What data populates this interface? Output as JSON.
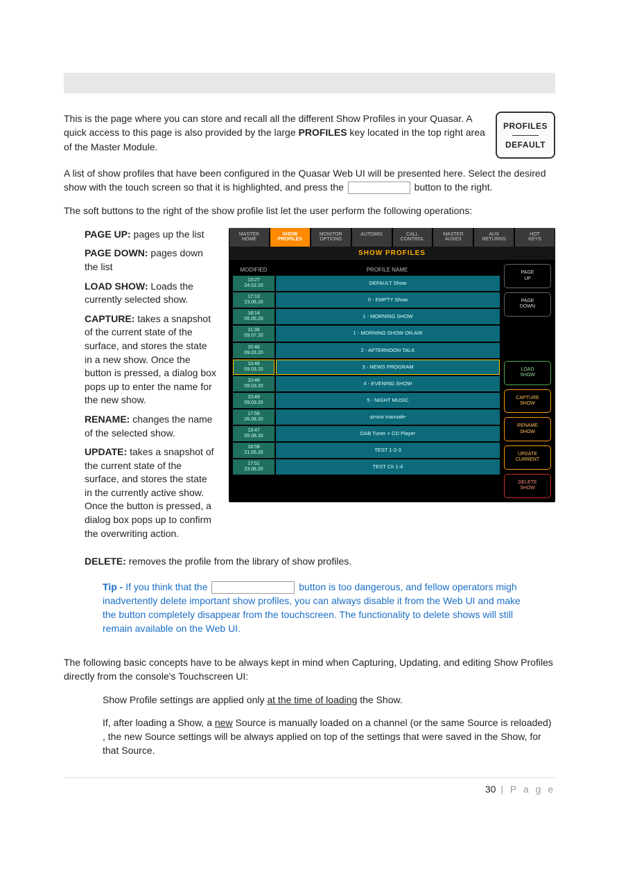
{
  "topbar": "",
  "intro": {
    "p1a": "This is the page where you can store and recall all the different Show Profiles in your Quasar. A quick access to this page is also provided by the large ",
    "p1b": "PROFILES",
    "p1c": " key located in the top right area of the Master Module.",
    "key_top": "PROFILES",
    "key_bottom": "DEFAULT"
  },
  "p2a": "A list of show profiles that have been configured in the Quasar Web UI will be presented here. Select the desired show with the touch screen so that it is highlighted, and press the ",
  "p2b": " button to the right.",
  "p3": "The soft buttons to the right of the show profile list  let the user perform the following operations:",
  "defs": {
    "pageup_l": "PAGE UP:",
    "pageup_t": " pages up the list",
    "pagedown_l": "PAGE DOWN:",
    "pagedown_t": " pages down the list",
    "load_l": "LOAD SHOW:",
    "load_t": " Loads the currently selected show.",
    "capture_l": "CAPTURE:",
    "capture_t": " takes a snapshot of the current state of the surface, and stores the state in a new show. Once the button is pressed, a dialog box pops up to enter the name for the new show.",
    "rename_l": "RENAME:",
    "rename_t": " changes the name of the selected show.",
    "update_l": "UPDATE:",
    "update_t": " takes a snapshot of the current state of the surface, and stores the state in the currently active show. Once the button is pressed, a dialog box pops up to confirm the overwriting action."
  },
  "delete_l": "DELETE:",
  "delete_t": " removes the profile from the library of show profiles.",
  "screenshot": {
    "tabs": [
      "MASTER HOME",
      "SHOW PROFILES",
      "MONITOR OPTIONS",
      "AUTOMIX",
      "CALL CONTROL",
      "MASTER AUXES",
      "AUX RETURNS",
      "HOT KEYS"
    ],
    "title": "SHOW PROFILES",
    "head_modified": "MODIFIED",
    "head_name": "PROFILE NAME",
    "rows": [
      {
        "t": "13:27",
        "d": "24.02.20",
        "n": "DEFAULT Show"
      },
      {
        "t": "17:13",
        "d": "23.06.20",
        "n": "0 - EMPTY Show"
      },
      {
        "t": "18:14",
        "d": "05.05.20",
        "n": "1 - MORNING SHOW"
      },
      {
        "t": "11:36",
        "d": "09.07.20",
        "n": "1 - MORNING SHOW ON AIR"
      },
      {
        "t": "10:48",
        "d": "09.03.20",
        "n": "2 - AFTERNOON TALK"
      },
      {
        "t": "10:48",
        "d": "09.03.20",
        "n": "3 - NEWS PROGRAM",
        "sel": true
      },
      {
        "t": "10:48",
        "d": "09.03.20",
        "n": "4 - EVENING SHOW"
      },
      {
        "t": "10:49",
        "d": "09.03.20",
        "n": "5 - NIGHT MUSIC"
      },
      {
        "t": "17:56",
        "d": "26.08.20",
        "n": "-prova manuale-"
      },
      {
        "t": "13:47",
        "d": "05.08.20",
        "n": "DAB Tuner + CD Player"
      },
      {
        "t": "18:58",
        "d": "21.05.20",
        "n": "TEST 1-2-3"
      },
      {
        "t": "17:51",
        "d": "23.06.20",
        "n": "TEST Ch 1-4"
      }
    ],
    "btns": [
      {
        "l": "PAGE UP",
        "c": ""
      },
      {
        "l": "PAGE DOWN",
        "c": ""
      },
      {
        "l": "LOAD SHOW",
        "c": "green"
      },
      {
        "l": "CAPTURE SHOW",
        "c": "orange"
      },
      {
        "l": "RENAME SHOW",
        "c": "orange"
      },
      {
        "l": "UPDATE CURRENT",
        "c": "orange"
      },
      {
        "l": "DELETE SHOW",
        "c": "red"
      }
    ]
  },
  "tip": {
    "label": "Tip - ",
    "t1": "If you think that the ",
    "t2": " button is too dangerous, and fellow operators migh inadvertently delete important show profiles, you can always disable it from the Web UI and make the button completely disappear from the touchscreen. The functionality to delete shows will still remain available on the Web UI."
  },
  "concepts": {
    "intro": "The following basic concepts have to be always kept in mind when Capturing, Updating, and editing Show Profiles directly from the console's Touchscreen UI:",
    "c1a": "Show Profile settings are applied only ",
    "c1u": "at the time of loading",
    "c1b": " the Show.",
    "c2a": "If, after loading a Show, a ",
    "c2u": "new",
    "c2b": " Source is manually loaded on a channel (or the same Source is reloaded) , the new Source settings will be always applied on top of the settings that were saved in the Show, for that Source."
  },
  "footer": {
    "num": "30",
    "rest": " | P a g e"
  }
}
